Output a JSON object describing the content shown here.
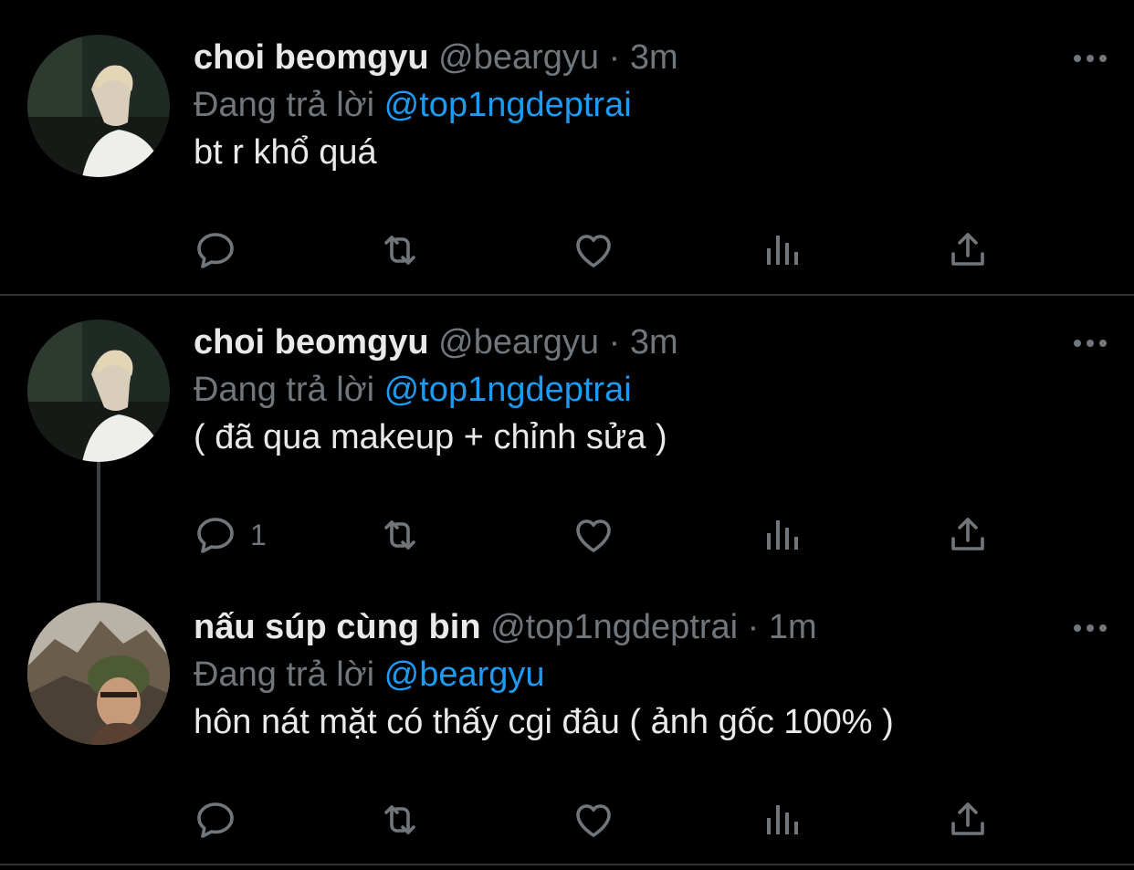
{
  "tweets": [
    {
      "name": "choi beomgyu",
      "handle": "@beargyu",
      "dot": "·",
      "time": "3m",
      "reply_prefix": "Đang trả lời",
      "reply_to": "@top1ngdeptrai",
      "text": "bt r khổ quá",
      "reply_count": ""
    },
    {
      "name": "choi beomgyu",
      "handle": "@beargyu",
      "dot": "·",
      "time": "3m",
      "reply_prefix": "Đang trả lời",
      "reply_to": "@top1ngdeptrai",
      "text": "( đã qua makeup + chỉnh sửa )",
      "reply_count": "1"
    },
    {
      "name": "nấu súp cùng bin",
      "handle": "@top1ngdeptrai",
      "dot": "·",
      "time": "1m",
      "reply_prefix": "Đang trả lời",
      "reply_to": "@beargyu",
      "text": "hôn nát mặt có thấy cgi đâu ( ảnh gốc 100% )",
      "reply_count": ""
    }
  ],
  "icons": [
    "more-icon",
    "reply-icon",
    "retweet-icon",
    "like-icon",
    "analytics-icon",
    "share-icon"
  ],
  "colors": {
    "background": "#000000",
    "text": "#e7e9ea",
    "muted": "#71767b",
    "link": "#1d9bf0",
    "divider": "#2f3336"
  }
}
